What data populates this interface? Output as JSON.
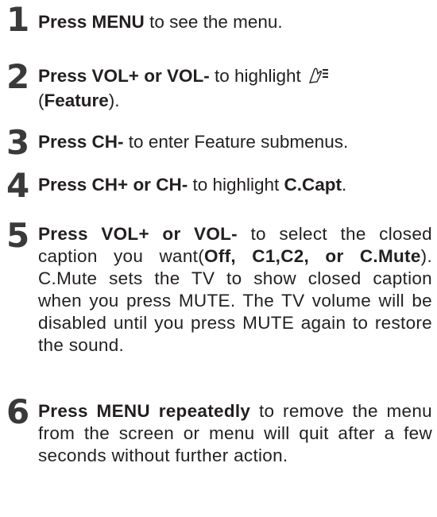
{
  "steps": [
    {
      "number": "1",
      "bold": "Press MENU",
      "text": " to see the menu."
    },
    {
      "number": "2",
      "bold": "Press VOL+ or VOL-",
      "text": " to highlight ",
      "icon": "feature-icon",
      "paren_open": "(",
      "paren_bold": "Feature",
      "paren_close": ")."
    },
    {
      "number": "3",
      "bold": "Press CH-",
      "text": " to enter Feature submenus."
    },
    {
      "number": "4",
      "bold": "Press CH+ or CH-",
      "text": " to highlight ",
      "bold2": "C.Capt",
      "text2": "."
    },
    {
      "number": "5",
      "bold": "Press VOL+ or VOL-",
      "text": " to select the closed caption you want(",
      "bold2": "Off, C1,C2, or C.Mute",
      "text2": "). C.Mute sets the TV to show closed caption when you press MUTE. The TV volume will be disabled until you press MUTE again to restore the sound."
    },
    {
      "number": "6",
      "bold": "Press MENU repeatedly",
      "text": " to remove the menu from the screen or menu will quit after a few seconds without further action."
    }
  ]
}
